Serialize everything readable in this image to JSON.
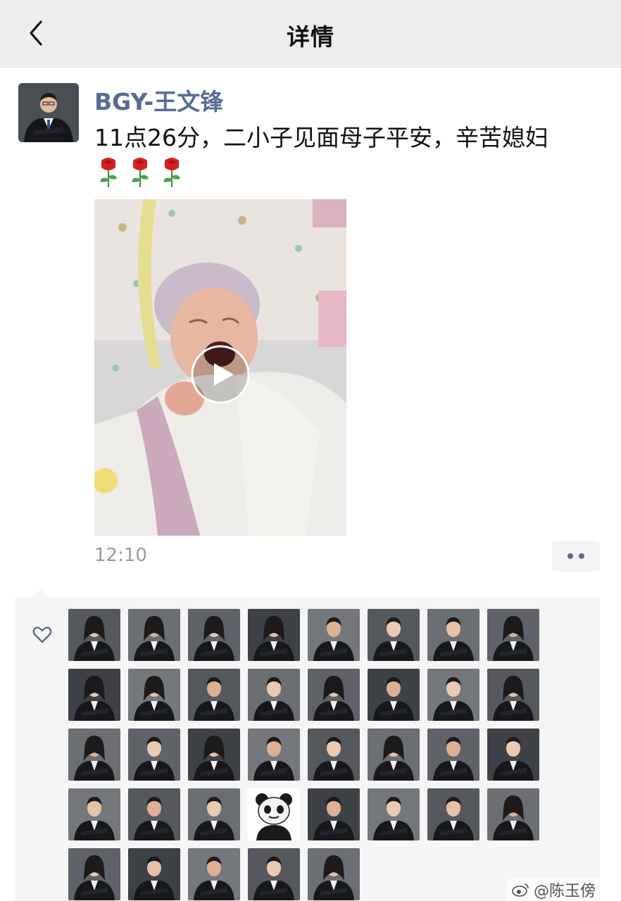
{
  "navbar": {
    "title": "详情",
    "back_icon": "chevron-left-icon"
  },
  "post": {
    "author": "BGY-王文锋",
    "text": "11点26分，二小子见面母子平安，辛苦媳妇",
    "emojis": [
      "rose-icon",
      "rose-icon",
      "rose-icon"
    ],
    "time": "12:10",
    "video": {
      "thumbnail": "newborn-baby-crying",
      "play_icon": "play-icon"
    }
  },
  "likes": {
    "heart_icon": "heart-icon",
    "likers": [
      "f",
      "f",
      "f",
      "f",
      "m",
      "m",
      "m",
      "f",
      "f",
      "f",
      "m",
      "m",
      "f",
      "m",
      "m",
      "f",
      "f",
      "m",
      "f",
      "m",
      "m",
      "f",
      "m",
      "m",
      "m",
      "m",
      "m",
      "panda",
      "m",
      "m",
      "m",
      "f",
      "f",
      "m",
      "m",
      "m",
      "f"
    ]
  },
  "watermark": {
    "text": "@陈玉傍"
  }
}
